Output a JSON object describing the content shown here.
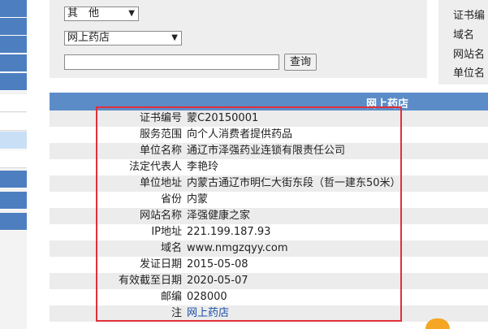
{
  "search": {
    "category_value": "其　他",
    "type_value": "网上药店",
    "query_button": "查询"
  },
  "right_panel": {
    "labels": [
      "证书编",
      "域名",
      "网站名",
      "单位名"
    ]
  },
  "results": {
    "header": "网上药店",
    "rows": [
      {
        "label": "证书编号",
        "value": "蒙C20150001"
      },
      {
        "label": "服务范围",
        "value": "向个人消费者提供药品"
      },
      {
        "label": "单位名称",
        "value": "通辽市泽强药业连锁有限责任公司"
      },
      {
        "label": "法定代表人",
        "value": "李艳玲"
      },
      {
        "label": "单位地址",
        "value": "内蒙古通辽市明仁大街东段（哲一建东50米）"
      },
      {
        "label": "省份",
        "value": "内蒙"
      },
      {
        "label": "网站名称",
        "value": "泽强健康之家"
      },
      {
        "label": "IP地址",
        "value": "221.199.187.93"
      },
      {
        "label": "域名",
        "value": "www.nmgzqyy.com"
      },
      {
        "label": "发证日期",
        "value": "2015-05-08"
      },
      {
        "label": "有效截至日期",
        "value": "2020-05-07"
      },
      {
        "label": "邮编",
        "value": "028000"
      },
      {
        "label": "注",
        "value": "网上药店"
      }
    ]
  },
  "colors": {
    "header_bg": "#5b8cc8",
    "sidebar_blue": "#4d7fc0",
    "highlight": "#e0303a",
    "link": "#1a4fa8"
  }
}
